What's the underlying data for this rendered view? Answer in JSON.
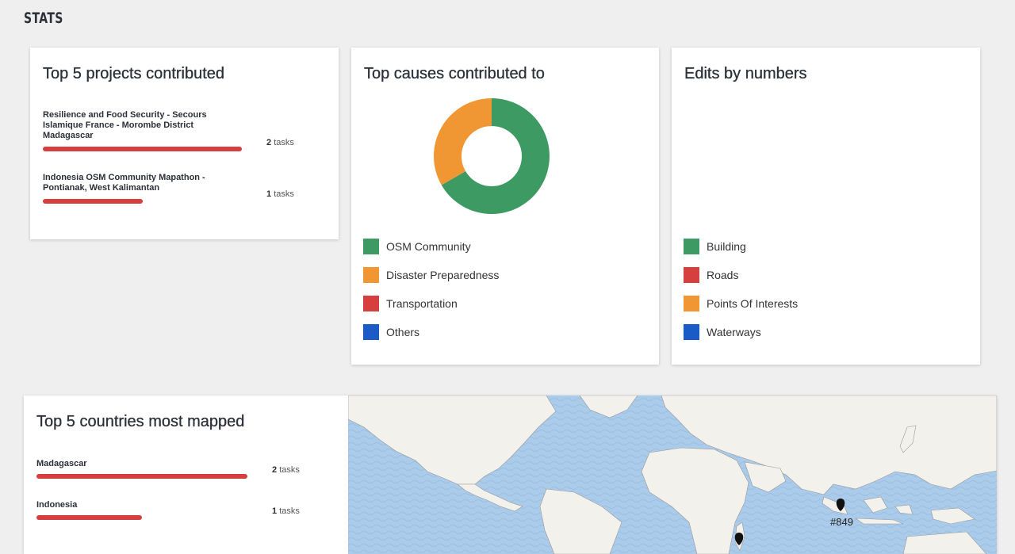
{
  "section_title": "STATS",
  "projects": {
    "title": "Top 5 projects contributed",
    "items": [
      {
        "name": "Resilience and Food Security - Secours Islamique France - Morombe District Madagascar",
        "count": "2",
        "unit": "tasks",
        "fraction": 1.0
      },
      {
        "name": "Indonesia OSM Community Mapathon - Pontianak, West Kalimantan",
        "count": "1",
        "unit": "tasks",
        "fraction": 0.5
      }
    ]
  },
  "causes": {
    "title": "Top causes contributed to",
    "legend": [
      {
        "label": "OSM Community",
        "color": "#3d9a62"
      },
      {
        "label": "Disaster Preparedness",
        "color": "#f09733"
      },
      {
        "label": "Transportation",
        "color": "#d73f3f"
      },
      {
        "label": "Others",
        "color": "#1b5bc6"
      }
    ],
    "chart_data": {
      "type": "pie",
      "categories": [
        "OSM Community",
        "Disaster Preparedness"
      ],
      "values": [
        2,
        1
      ]
    }
  },
  "edits": {
    "title": "Edits by numbers",
    "legend": [
      {
        "label": "Building",
        "color": "#3d9a62"
      },
      {
        "label": "Roads",
        "color": "#d73f3f"
      },
      {
        "label": "Points Of Interests",
        "color": "#f09733"
      },
      {
        "label": "Waterways",
        "color": "#1b5bc6"
      }
    ]
  },
  "countries": {
    "title": "Top 5 countries most mapped",
    "items": [
      {
        "name": "Madagascar",
        "count": "2",
        "unit": "tasks",
        "fraction": 1.0
      },
      {
        "name": "Indonesia",
        "count": "1",
        "unit": "tasks",
        "fraction": 0.5
      }
    ]
  },
  "map": {
    "marker_label": "#849"
  }
}
